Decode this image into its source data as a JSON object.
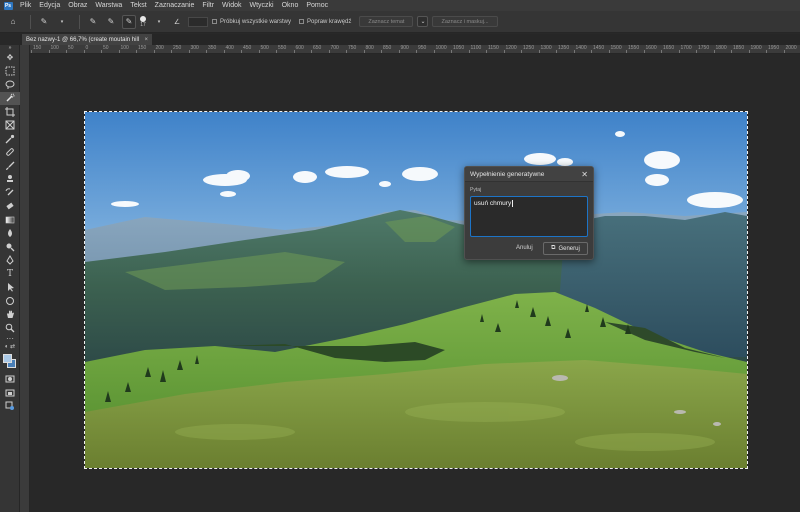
{
  "menubar": {
    "logo": "Ps",
    "items": [
      "Plik",
      "Edycja",
      "Obraz",
      "Warstwa",
      "Tekst",
      "Zaznaczanie",
      "Filtr",
      "Widok",
      "Wtyczki",
      "Okno",
      "Pomoc"
    ]
  },
  "options_bar": {
    "brush_size": "17",
    "angle_icon": "angle-icon",
    "sample_all_layers_label": "Próbkuj wszystkie warstwy",
    "refine_edge_label": "Popraw krawędź",
    "select_subject_label": "Zaznacz temat",
    "select_and_mask_label": "Zaznacz i maskuj..."
  },
  "document_tab": {
    "title": "Bez nazwy-1 @ 66,7% (create moutain hill",
    "close": "×"
  },
  "ruler": {
    "labels": [
      "150",
      "100",
      "50",
      "0",
      "50",
      "100",
      "150",
      "200",
      "250",
      "300",
      "350",
      "400",
      "450",
      "500",
      "550",
      "600",
      "650",
      "700",
      "750",
      "800",
      "850",
      "900",
      "950",
      "1000",
      "1050",
      "1100",
      "1150",
      "1200",
      "1250",
      "1300",
      "1350",
      "1400",
      "1450",
      "1500",
      "1550",
      "1600",
      "1650",
      "1700",
      "1750",
      "1800",
      "1850",
      "1900",
      "1950",
      "2000"
    ]
  },
  "dialog": {
    "title": "Wypełnienie generatywne",
    "close": "✕",
    "prompt_label": "Pytaj",
    "prompt_value": "usuń chmury",
    "cancel_label": "Anuluj",
    "generate_label": "Generuj"
  },
  "colors": {
    "foreground": "#a9c8e6",
    "background": "#4a7fb7",
    "accent": "#1d74c7"
  }
}
